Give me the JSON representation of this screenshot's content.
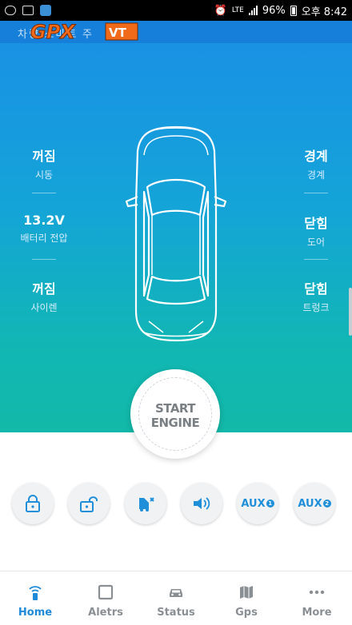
{
  "status_bar": {
    "network_small": "LTE",
    "battery_text": "96%",
    "time": "오후 8:42"
  },
  "header": {
    "subtitle": "차량 스마트 주",
    "logo_text": "GPX",
    "logo_badge": "VT"
  },
  "stats_left": [
    {
      "value": "꺼짐",
      "label": "시동"
    },
    {
      "value": "13.2V",
      "label": "배터리 전압"
    },
    {
      "value": "꺼짐",
      "label": "사이렌"
    }
  ],
  "stats_right": [
    {
      "value": "경계",
      "label": "경계"
    },
    {
      "value": "닫힘",
      "label": "도어"
    },
    {
      "value": "닫힘",
      "label": "트렁크"
    }
  ],
  "start_button": {
    "line1": "START",
    "line2": "ENGINE"
  },
  "actions": {
    "aux1_label": "AUX",
    "aux1_num": "1",
    "aux2_label": "AUX",
    "aux2_num": "2"
  },
  "tabs": [
    {
      "label": "Home",
      "icon": "remote-signal-icon",
      "active": true
    },
    {
      "label": "Aletrs",
      "icon": "square-icon"
    },
    {
      "label": "Status",
      "icon": "car-icon"
    },
    {
      "label": "Gps",
      "icon": "map-icon"
    },
    {
      "label": "More",
      "icon": "dots-icon"
    }
  ],
  "colors": {
    "accent": "#1e8ad8",
    "gradient_top": "#1a8fe6",
    "gradient_bottom": "#12b9a8"
  }
}
